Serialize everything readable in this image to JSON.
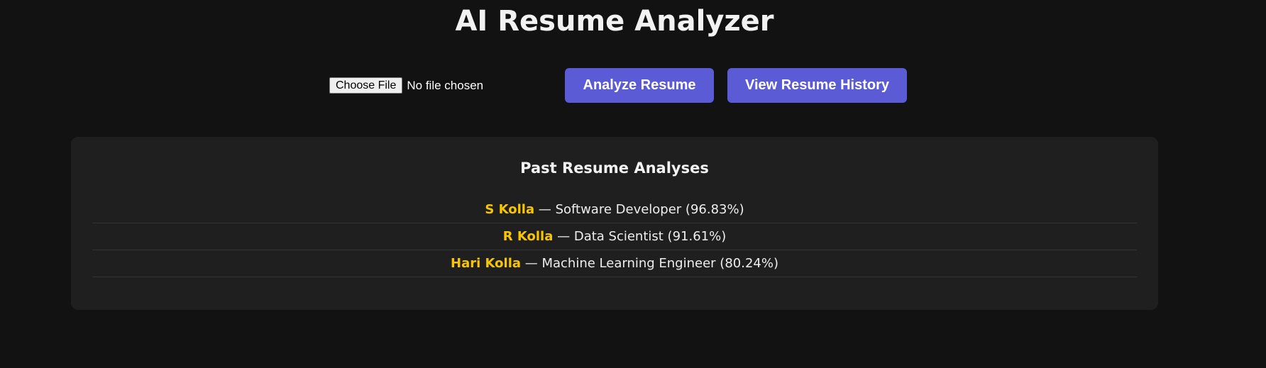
{
  "header": {
    "title": "AI Resume Analyzer"
  },
  "upload": {
    "choose_file_label": "Choose File",
    "file_status": "No file chosen"
  },
  "actions": {
    "analyze_label": "Analyze Resume",
    "history_label": "View Resume History"
  },
  "history": {
    "title": "Past Resume Analyses",
    "separator": " — ",
    "items": [
      {
        "name": "S Kolla",
        "detail": "Software Developer (96.83%)"
      },
      {
        "name": "R Kolla",
        "detail": "Data Scientist (91.61%)"
      },
      {
        "name": "Hari Kolla",
        "detail": "Machine Learning Engineer (80.24%)"
      }
    ]
  },
  "colors": {
    "background": "#121212",
    "panel": "#1f1f1f",
    "button": "#5b5bd6",
    "name_highlight": "#f7c600"
  }
}
